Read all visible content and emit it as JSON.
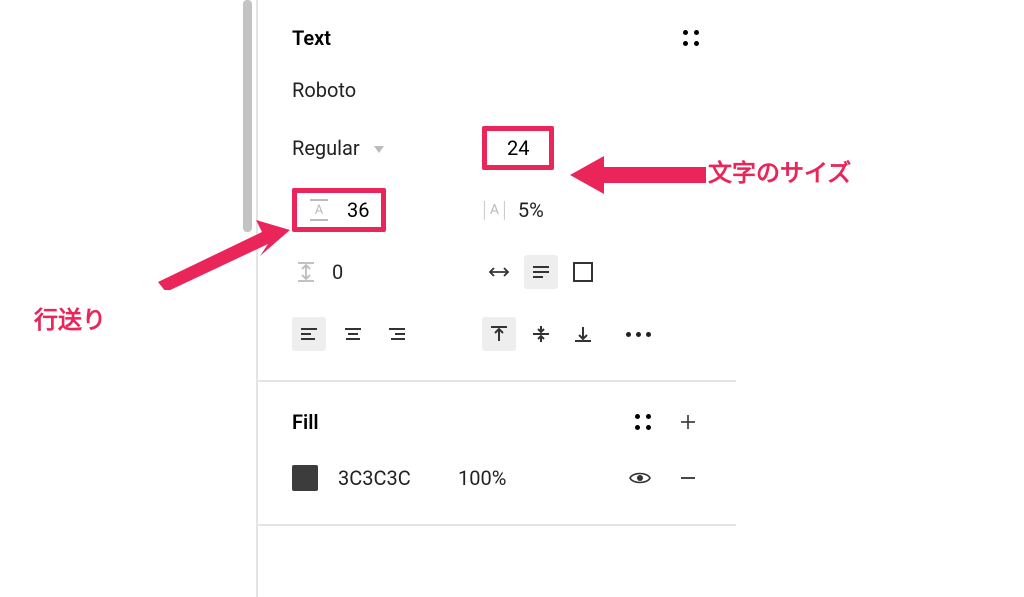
{
  "text_section": {
    "title": "Text",
    "font_family": "Roboto",
    "font_weight": "Regular",
    "font_size": "24",
    "line_height": "36",
    "letter_spacing": "5%",
    "paragraph_spacing": "0"
  },
  "fill_section": {
    "title": "Fill",
    "hex": "3C3C3C",
    "opacity": "100%"
  },
  "annotations": {
    "font_size_label": "文字のサイズ",
    "line_height_label": "行送り"
  },
  "colors": {
    "highlight": "#e9255a"
  }
}
